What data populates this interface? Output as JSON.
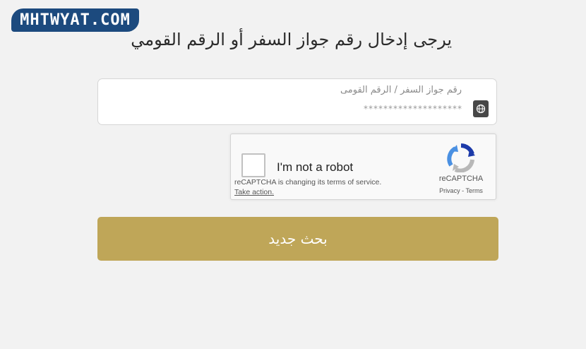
{
  "logo": {
    "text": "MHTWYAT.COM"
  },
  "heading": "يرجى إدخال رقم جواز السفر أو الرقم القومي",
  "field": {
    "label": "رقم جواز السفر / الرقم القومى",
    "placeholder": "********************",
    "icon": "globe-icon"
  },
  "captcha": {
    "checkbox_label": "I'm not a robot",
    "notice": "reCAPTCHA is changing its terms of service.",
    "take_action": "Take action.",
    "brand": "reCAPTCHA",
    "privacy": "Privacy",
    "separator": "-",
    "terms": "Terms"
  },
  "button": {
    "label": "بحث جديد"
  },
  "colors": {
    "logo_bg": "#1c4a7e",
    "button_bg": "#bfa658",
    "page_bg": "#f2f2f2"
  }
}
